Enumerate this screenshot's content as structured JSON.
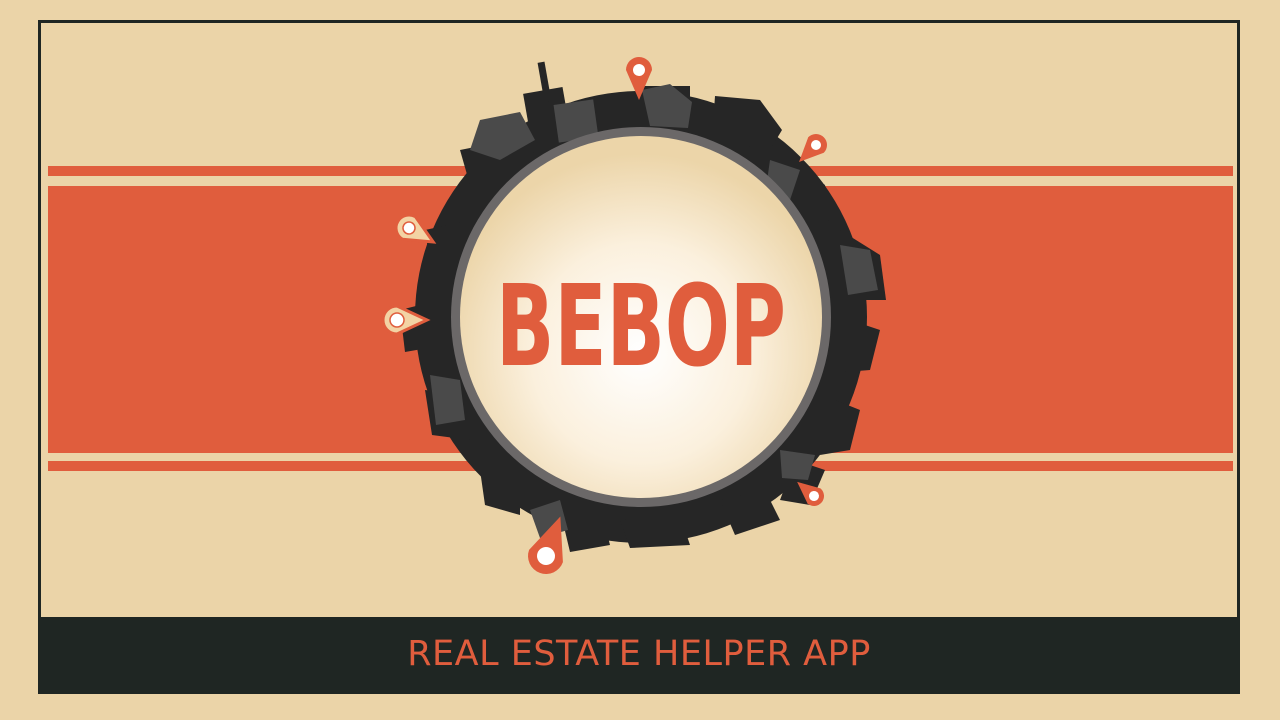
{
  "app": {
    "logo_text": "BEBOP",
    "tagline": "REAL ESTATE HELPER APP"
  },
  "colors": {
    "background": "#ebd4a8",
    "accent": "#e05d3d",
    "dark": "#1f2623",
    "building_dark": "#262626",
    "building_mid": "#4a4a4a",
    "ring": "#6b6868"
  },
  "icons": {
    "pins": "map-pin-icon",
    "skyline": "city-skyline-icon"
  }
}
